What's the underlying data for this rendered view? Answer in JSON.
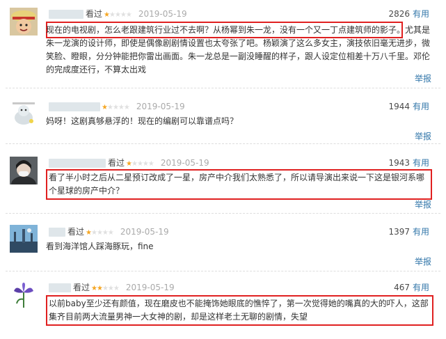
{
  "reviews": [
    {
      "seen": "看过",
      "date": "2019-05-19",
      "votes": "2826",
      "useful": "有用",
      "content": "现在的电视剧，怎么老跟建筑行业过不去啊？从杨幂到朱一龙，没有一个又一丁点建筑师的影子。尤其是朱一龙演的设计师，即使是偶像剧剧情设置也太夸张了吧。杨颖演了这么多女主，演技依旧毫无进步，微笑脸、瞪眼，分分钟能把你雷出画面。朱一龙总是一副没睡醒的样子，跟人设定位相差十万八千里。邓伦的完成度还行，不算太出戏",
      "report": "举报",
      "rating": 1
    },
    {
      "seen": "看过",
      "date": "2019-05-19",
      "votes": "1944",
      "useful": "有用",
      "content": "妈呀！这剧真够悬浮的！现在的编剧可以靠谱点吗？",
      "report": "举报",
      "rating": 1
    },
    {
      "seen": "看过",
      "date": "2019-05-19",
      "votes": "1943",
      "useful": "有用",
      "content": "看了半小时之后从二星预订改成了一星，房产中介我们太熟悉了，所以请导演出来说一下这是银河系哪个星球的房产中介？",
      "report": "举报",
      "rating": 1
    },
    {
      "seen": "看过",
      "date": "2019-05-19",
      "votes": "1397",
      "useful": "有用",
      "content": "看到海洋馆人踩海豚玩，fine",
      "report": "举报",
      "rating": 1
    },
    {
      "seen": "看过",
      "date": "2019-05-19",
      "votes": "467",
      "useful": "有用",
      "content": "以前baby至少还有颜值，现在磨皮也不能掩饰她眼底的憔悴了，第一次觉得她的嘴真的大的吓人，这部集齐目前两大流量男神一大女神的剧，却是这样老土无聊的剧情，失望",
      "report": "",
      "rating": 2
    }
  ],
  "star_glyph": "★",
  "colors": {
    "highlight": "#e02020",
    "link": "#3377aa",
    "star": "#f5a623",
    "date": "#aaaaaa"
  }
}
